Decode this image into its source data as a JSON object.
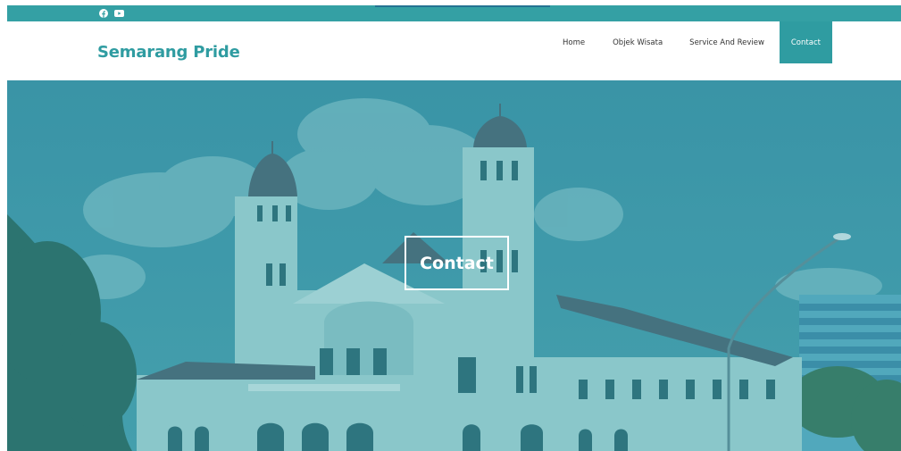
{
  "social": {
    "icons": [
      "facebook-icon",
      "youtube-icon"
    ]
  },
  "header": {
    "brand": "Semarang Pride",
    "nav": {
      "home": "Home",
      "objek_wisata": "Objek Wisata",
      "service_review": "Service And Review",
      "contact": "Contact"
    },
    "active": "Contact"
  },
  "hero": {
    "title": "Contact"
  },
  "colors": {
    "accent": "#2f9ca1",
    "topbar": "#34a0a4",
    "overlay": "#2f8fa0"
  }
}
